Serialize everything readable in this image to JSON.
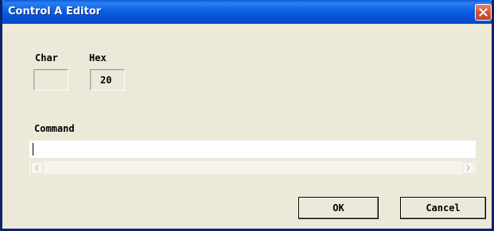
{
  "window": {
    "title": "Control A Editor",
    "close_icon": "close-icon"
  },
  "fields": {
    "char_label": "Char",
    "char_value": "",
    "hex_label": "Hex",
    "hex_value": "20",
    "command_label": "Command",
    "command_value": ""
  },
  "buttons": {
    "ok_label": "OK",
    "cancel_label": "Cancel"
  },
  "colors": {
    "titlebar": "#0553d6",
    "dialog_background": "#ece9d8",
    "close_button": "#d9583c"
  }
}
